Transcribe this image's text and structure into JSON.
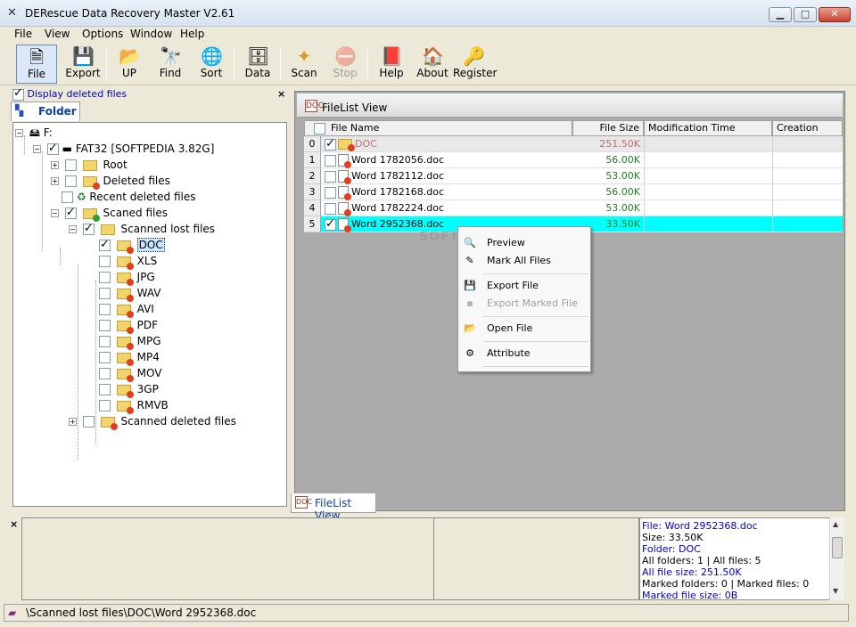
{
  "window": {
    "title": "DERescue Data Recovery Master V2.61",
    "controls": {
      "minimize": "▁",
      "maximize": "□",
      "close": "✕"
    }
  },
  "menu": [
    "File",
    "View",
    "Options",
    "Window",
    "Help"
  ],
  "toolbar": [
    {
      "label": "File",
      "icon": "file-icon",
      "glyph": "🗎",
      "state": "active"
    },
    {
      "label": "Export",
      "icon": "export-icon",
      "glyph": "💾"
    },
    {
      "label": "UP",
      "icon": "up-folder-icon",
      "glyph": "📂"
    },
    {
      "label": "Find",
      "icon": "find-icon",
      "glyph": "🔭"
    },
    {
      "label": "Sort",
      "icon": "sort-icon",
      "glyph": "🌐"
    },
    {
      "label": "Data",
      "icon": "data-icon",
      "glyph": "🗄"
    },
    {
      "label": "Scan",
      "icon": "scan-icon",
      "glyph": "✦"
    },
    {
      "label": "Stop",
      "icon": "stop-icon",
      "glyph": "⛔",
      "state": "disabled"
    },
    {
      "label": "Help",
      "icon": "help-icon",
      "glyph": "📕"
    },
    {
      "label": "About",
      "icon": "about-icon",
      "glyph": "🏠"
    },
    {
      "label": "Register",
      "icon": "register-icon",
      "glyph": "🔑"
    }
  ],
  "left_panel": {
    "display_deleted_label": "Display deleted files",
    "display_deleted_checked": true,
    "close": "×",
    "tab_label": "Folder",
    "tree": {
      "drive": "F:",
      "volume": "FAT32 [SOFTPEDIA 3.82G]",
      "root": "Root",
      "deleted": "Deleted files",
      "recent_deleted": "Recent deleted files",
      "scaned": "Scaned files",
      "scanned_lost": "Scanned lost files",
      "types": [
        "DOC",
        "XLS",
        "JPG",
        "WAV",
        "AVI",
        "PDF",
        "MPG",
        "MP4",
        "MOV",
        "3GP",
        "RMVB"
      ],
      "scanned_deleted": "Scanned deleted files"
    }
  },
  "filelist": {
    "header_title": "FileList View",
    "columns": [
      "File Name",
      "File Size",
      "Modification Time",
      "Creation Time"
    ],
    "rows": [
      {
        "idx": "0",
        "name": "DOC",
        "size": "251.50K",
        "checked": true,
        "folder": true
      },
      {
        "idx": "1",
        "name": "Word 1782056.doc",
        "size": "56.00K",
        "checked": false
      },
      {
        "idx": "2",
        "name": "Word 1782112.doc",
        "size": "53.00K",
        "checked": false
      },
      {
        "idx": "3",
        "name": "Word 1782168.doc",
        "size": "56.00K",
        "checked": false
      },
      {
        "idx": "4",
        "name": "Word 1782224.doc",
        "size": "53.00K",
        "checked": false
      },
      {
        "idx": "5",
        "name": "Word 2952368.doc",
        "size": "33.50K",
        "checked": true,
        "selected": true
      }
    ],
    "bottom_tab": "FileList View"
  },
  "context_menu": [
    {
      "label": "Preview",
      "icon": "preview-icon",
      "glyph": "🔍"
    },
    {
      "label": "Mark All Files",
      "icon": "mark-all-icon",
      "glyph": "✎"
    },
    {
      "label": "Export File",
      "icon": "export-file-icon",
      "glyph": "💾"
    },
    {
      "label": "Export Marked File",
      "icon": "export-marked-icon",
      "glyph": "▪",
      "disabled": true
    },
    {
      "label": "Open File",
      "icon": "open-file-icon",
      "glyph": "📂"
    },
    {
      "label": "Attribute",
      "icon": "attribute-icon",
      "glyph": "⚙"
    }
  ],
  "info_panel": {
    "close": "×",
    "lines": [
      "File: Word 2952368.doc",
      "Size: 33.50K",
      "Folder: DOC",
      "All folders: 1  | All files: 5",
      " All file size: 251.50K",
      "Marked folders: 0  | Marked files: 0",
      "Marked file size: 0B"
    ]
  },
  "status": {
    "path": "\\Scanned lost files\\DOC\\Word 2952368.doc"
  },
  "watermark": "SOFTPEDIA",
  "colors": {
    "selection": "#00ffff",
    "size_text": "#208020",
    "link_blue": "#0000cc"
  }
}
